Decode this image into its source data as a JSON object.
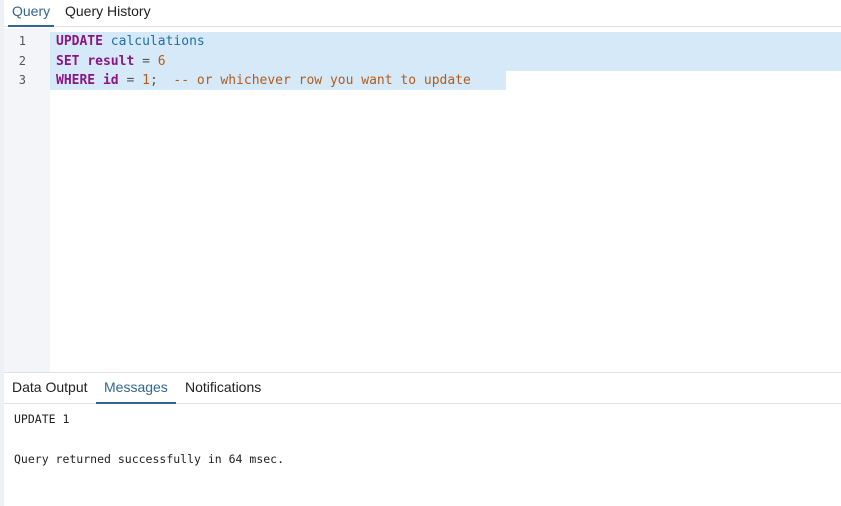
{
  "top_tabs": {
    "query": "Query",
    "query_history": "Query History"
  },
  "editor": {
    "line_numbers": [
      "1",
      "2",
      "3"
    ],
    "lines": [
      {
        "keyword": "UPDATE",
        "table": "calculations"
      },
      {
        "keyword": "SET",
        "column": "result",
        "operator": "=",
        "value": "6"
      },
      {
        "keyword": "WHERE",
        "column": "id",
        "operator": "=",
        "value": "1",
        "terminator": ";",
        "comment": "-- or whichever row you want to update"
      }
    ],
    "selection_color": "#d6e9f8"
  },
  "bottom_tabs": {
    "data_output": "Data Output",
    "messages": "Messages",
    "notifications": "Notifications",
    "active": "messages"
  },
  "messages": {
    "line1": "UPDATE 1",
    "line2": "Query returned successfully in 64 msec."
  },
  "colors": {
    "accent": "#326690",
    "keyword": "#8a1585",
    "table": "#1d6fa5",
    "number": "#b05c1d"
  }
}
